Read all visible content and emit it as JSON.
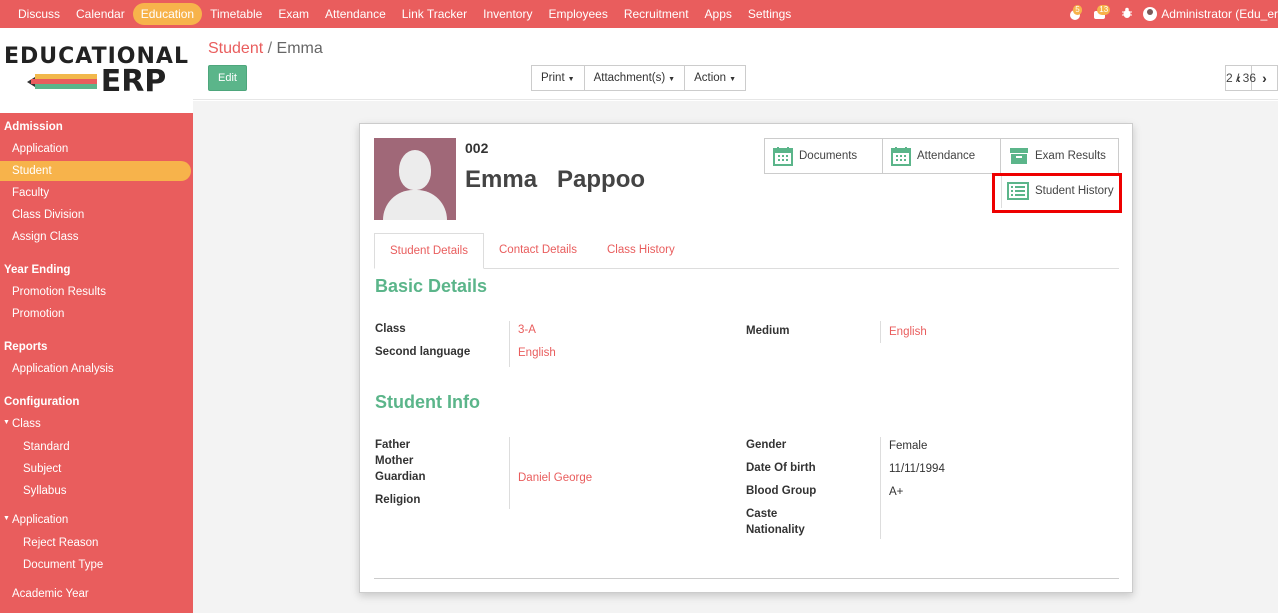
{
  "topbar": {
    "menu": [
      "Discuss",
      "Calendar",
      "Education",
      "Timetable",
      "Exam",
      "Attendance",
      "Link Tracker",
      "Inventory",
      "Employees",
      "Recruitment",
      "Apps",
      "Settings"
    ],
    "active": "Education",
    "chat_count": "5",
    "activity_count": "13",
    "user": "Administrator (Edu_er"
  },
  "logo": {
    "line1": "EDUCATIONAL",
    "line2": "ERP"
  },
  "sidebar": {
    "admission": "Admission",
    "application": "Application",
    "student": "Student",
    "faculty": "Faculty",
    "class_division": "Class Division",
    "assign_class": "Assign Class",
    "year_ending": "Year Ending",
    "promotion_results": "Promotion Results",
    "promotion": "Promotion",
    "reports": "Reports",
    "application_analysis": "Application Analysis",
    "configuration": "Configuration",
    "class": "Class",
    "standard": "Standard",
    "subject": "Subject",
    "syllabus": "Syllabus",
    "application_group": "Application",
    "reject_reason": "Reject Reason",
    "document_type": "Document Type",
    "academic_year": "Academic Year"
  },
  "control": {
    "breadcrumb_parent": "Student",
    "breadcrumb_sep": "/",
    "breadcrumb_current": "Emma",
    "edit": "Edit",
    "print": "Print",
    "attachments": "Attachment(s)",
    "action": "Action",
    "pager": "2 / 36"
  },
  "record": {
    "id": "002",
    "name": "Emma   Pappoo",
    "buttons": {
      "documents": "Documents",
      "attendance": "Attendance",
      "exam_results": "Exam Results",
      "student_history": "Student History"
    },
    "tabs": [
      "Student Details",
      "Contact Details",
      "Class History"
    ],
    "basic": {
      "title": "Basic Details",
      "class_label": "Class",
      "class_value": "3-A",
      "second_language_label": "Second language",
      "second_language_value": "English",
      "medium_label": "Medium",
      "medium_value": "English"
    },
    "info": {
      "title": "Student Info",
      "father": "Father",
      "mother": "Mother",
      "guardian": "Guardian",
      "guardian_value": "Daniel George",
      "religion": "Religion",
      "gender": "Gender",
      "gender_value": "Female",
      "dob": "Date Of birth",
      "dob_value": "11/11/1994",
      "blood": "Blood Group",
      "blood_value": "A+",
      "caste": "Caste",
      "nationality": "Nationality"
    }
  },
  "colors": {
    "brand": "#e95d5d",
    "accent": "#f7b34b",
    "green": "#5bb58a"
  }
}
